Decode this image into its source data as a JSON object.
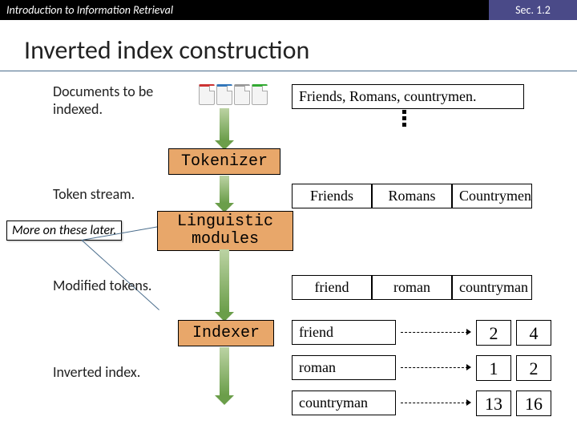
{
  "header": {
    "left": "Introduction to Information Retrieval",
    "right": "Sec. 1.2"
  },
  "title": "Inverted index construction",
  "labels": {
    "documents": "Documents to be indexed.",
    "token_stream": "Token stream.",
    "modified_tokens": "Modified tokens.",
    "inverted_index": "Inverted index.",
    "note": "More on these later."
  },
  "document_text": "Friends, Romans, countrymen.",
  "stages": {
    "tokenizer": "Tokenizer",
    "linguistic": "Linguistic modules",
    "indexer": "Indexer"
  },
  "tokens_raw": [
    "Friends",
    "Romans",
    "Countrymen"
  ],
  "tokens_mod": [
    "friend",
    "roman",
    "countryman"
  ],
  "index_terms": [
    "friend",
    "roman",
    "countryman"
  ],
  "postings": [
    [
      "2",
      "4"
    ],
    [
      "1",
      "2"
    ],
    [
      "13",
      "16"
    ]
  ]
}
